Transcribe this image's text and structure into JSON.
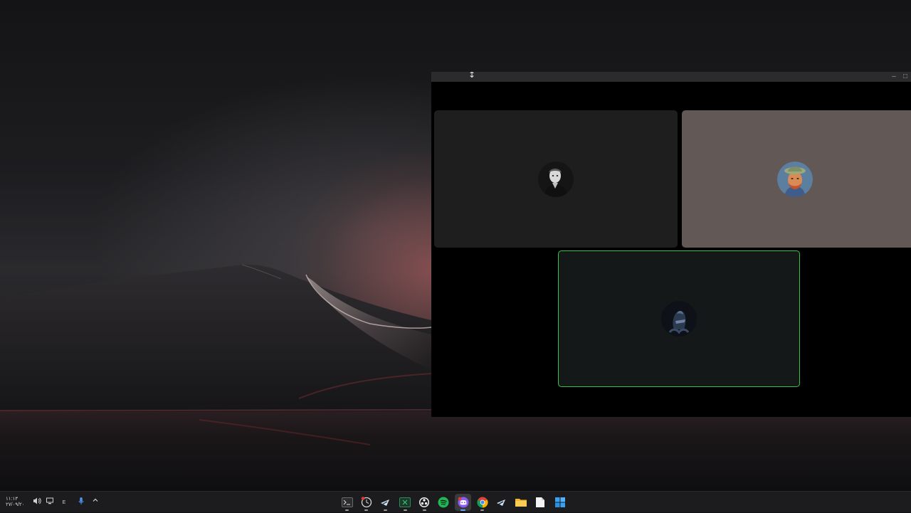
{
  "taskbar": {
    "clock_time": "١١:١٣",
    "clock_date": "٢٧/٠٩/٢٠",
    "language": "E",
    "icons": [
      "speaker-icon",
      "network-icon",
      "microphone-icon",
      "chevron-up-icon"
    ],
    "apps": [
      "terminal",
      "clock-app",
      "steam",
      "excel",
      "obs",
      "spotify",
      "discord",
      "chrome",
      "steam-2",
      "file-explorer",
      "notepad",
      "start"
    ]
  },
  "call": {
    "participants": [
      "participant-1",
      "participant-2",
      "participant-3"
    ],
    "active_speaker_color": "#3fbf52"
  },
  "colors": {
    "tile_dark": "#1e1e1e",
    "tile_brown": "#625856",
    "tile_active": "#141818"
  }
}
